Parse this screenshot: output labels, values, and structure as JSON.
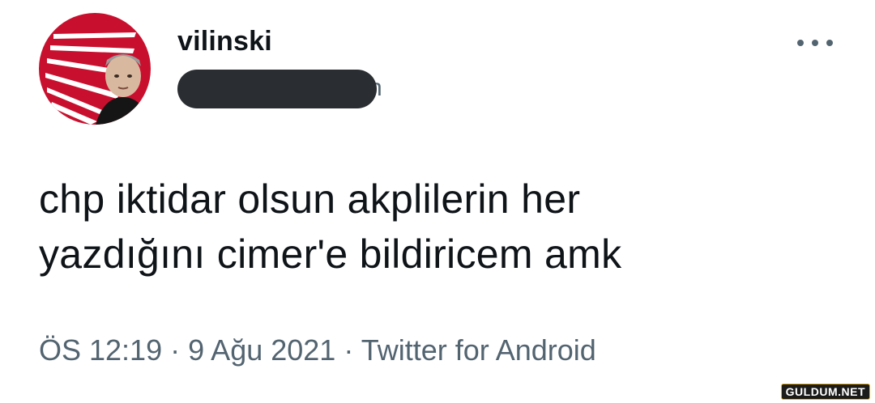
{
  "user": {
    "display_name": "vilinski",
    "handle_visible_suffix": "n"
  },
  "tweet": {
    "lines": [
      "chp iktidar olsun akplilerin her",
      "yazdığını cimer'e bildiricem amk"
    ]
  },
  "meta": {
    "time": "ÖS 12:19",
    "separator": "·",
    "date": "9 Ağu 2021",
    "source": "Twitter for Android"
  },
  "watermark": "GULDUM.NET",
  "icons": {
    "avatar": "chp-logo-avatar",
    "more": "more-dots-icon"
  },
  "colors": {
    "text_primary": "#0f1419",
    "text_secondary": "#536471",
    "avatar_red": "#c8102e",
    "redaction": "#2a2d31"
  }
}
